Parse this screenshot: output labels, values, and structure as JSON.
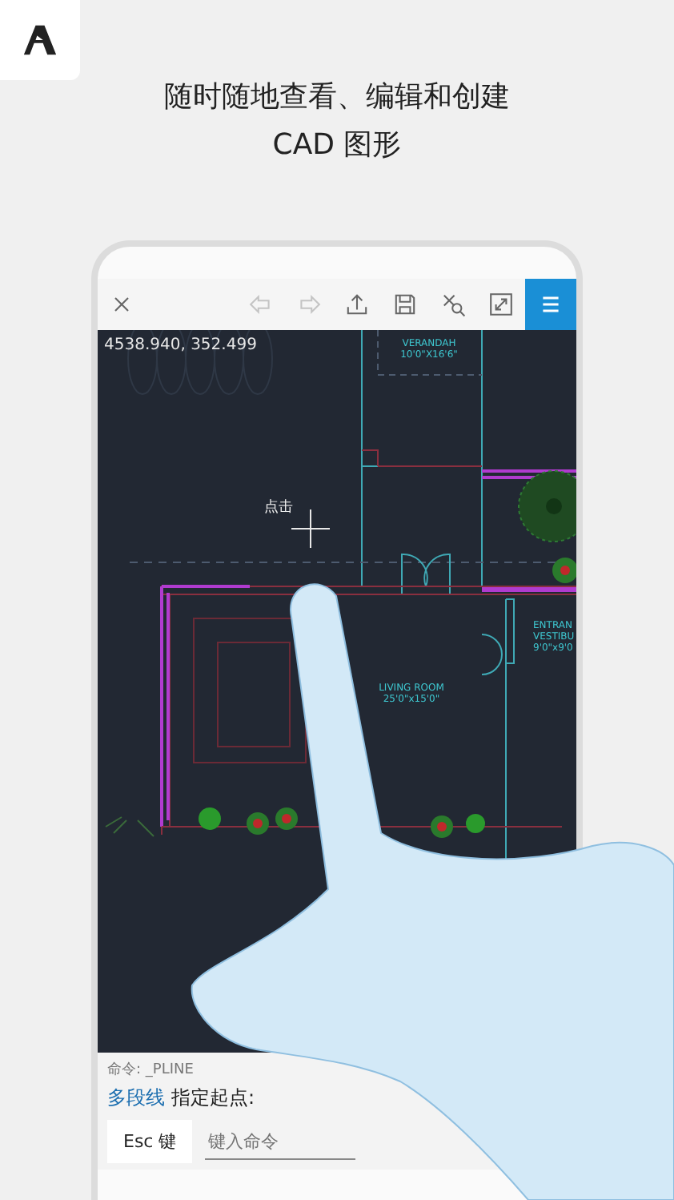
{
  "headline": [
    "随时随地查看、编辑和创建",
    "CAD 图形"
  ],
  "toolbar": {
    "buttons": [
      {
        "kind": "close",
        "disabled": false
      },
      {
        "kind": "undo",
        "disabled": true
      },
      {
        "kind": "redo",
        "disabled": true
      },
      {
        "kind": "share",
        "disabled": false
      },
      {
        "kind": "save",
        "disabled": false
      },
      {
        "kind": "zoom-select",
        "disabled": false
      },
      {
        "kind": "fullscreen",
        "disabled": false
      },
      {
        "kind": "menu",
        "disabled": false
      }
    ]
  },
  "canvas": {
    "coordinates": "4538.940, 352.499",
    "cursor_label": "点击",
    "rooms": [
      {
        "lines": [
          "VERANDAH",
          "10'0\"X16'6\""
        ]
      },
      {
        "lines": [
          "LIVING ROOM",
          "25'0\"x15'0\""
        ]
      },
      {
        "lines": [
          "ENTRAN",
          "VESTIBU",
          "9'0\"x9'0"
        ]
      }
    ]
  },
  "command_bar": {
    "history": "命令: _PLINE",
    "command": "多段线",
    "prompt": "指定起点:",
    "esc_button": "Esc 键",
    "input": {
      "placeholder": "键入命令"
    }
  }
}
